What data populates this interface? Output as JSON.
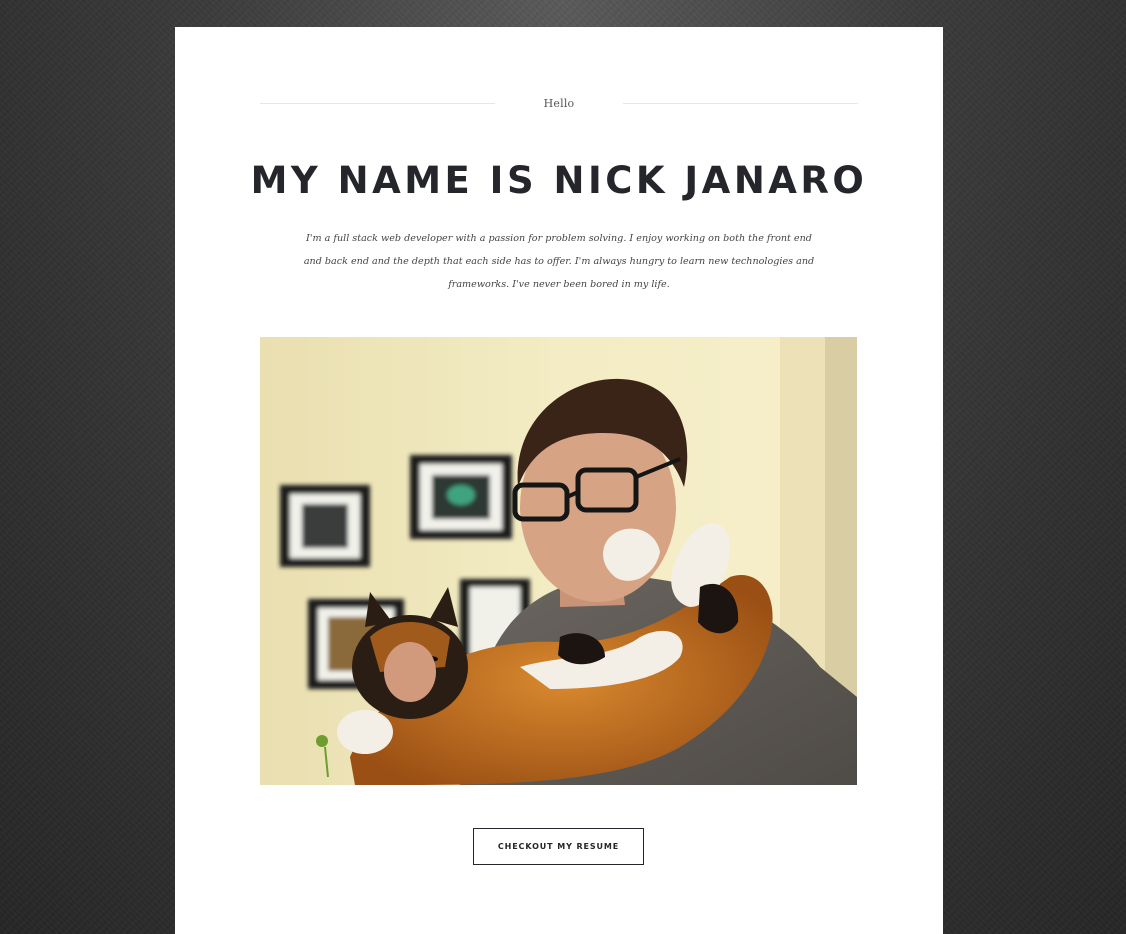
{
  "hero": {
    "eyebrow": "Hello",
    "title": "MY NAME IS NICK JANARO",
    "intro": "I'm a full stack web developer with a passion for problem solving. I enjoy working on both the front end and back end and the depth that each side has to offer. I'm always hungry to learn new technologies and frameworks. I've never been bored in my life.",
    "photo_icon": "profile-photo",
    "resume_button": "CHECKOUT MY RESUME"
  },
  "colors": {
    "page_background": "#3a3a3a",
    "card": "#ffffff",
    "heading": "#24262b",
    "body_text": "#444444"
  }
}
